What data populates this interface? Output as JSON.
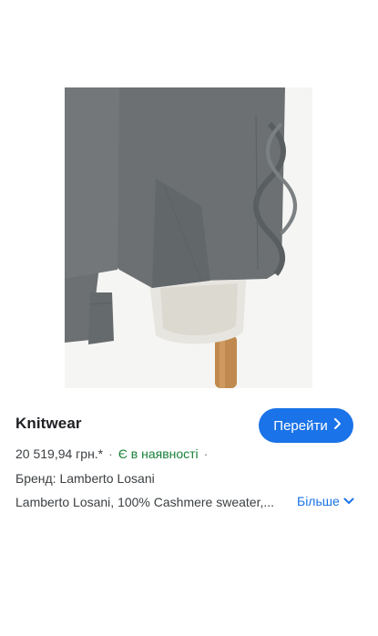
{
  "product": {
    "image_alt": "Grey cashmere knit sweater on mannequin",
    "title": "Knitwear",
    "go_button_label": "Перейти",
    "price": "20 519,94 грн.*",
    "availability": "Є в наявності",
    "brand_line": "Бренд: Lamberto Losani",
    "description": "Lamberto Losani, 100% Cashmere sweater,...",
    "more_label": "Більше"
  },
  "icons": {
    "go": "chevron-right-icon",
    "more": "chevron-down-icon"
  },
  "colors": {
    "accent": "#1a73e8",
    "in_stock": "#188038",
    "sweater": "#6c7072"
  }
}
